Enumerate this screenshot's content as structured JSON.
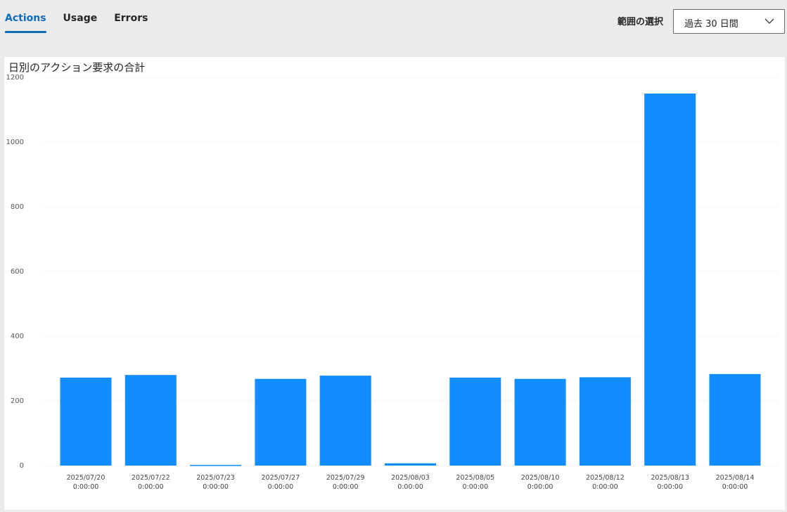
{
  "tabs": [
    {
      "label": "Actions",
      "active": true
    },
    {
      "label": "Usage",
      "active": false
    },
    {
      "label": "Errors",
      "active": false
    }
  ],
  "range": {
    "label": "範囲の選択",
    "selected": "過去 30 日間"
  },
  "colors": {
    "accent": "#0f6cbd",
    "bar": "#118dff",
    "background": "#ebebeb",
    "card": "#ffffff",
    "gridline": "#d6d6d6"
  },
  "icons": {
    "dropdown": "chevron-down-icon"
  },
  "chart_data": {
    "type": "bar",
    "title": "日別のアクション要求の合計",
    "xlabel": "",
    "ylabel": "",
    "ylim": [
      0,
      1200
    ],
    "yticks": [
      0,
      200,
      400,
      600,
      800,
      1000,
      1200
    ],
    "grid": true,
    "categories": [
      [
        "2025/07/20",
        "0:00:00"
      ],
      [
        "2025/07/22",
        "0:00:00"
      ],
      [
        "2025/07/23",
        "0:00:00"
      ],
      [
        "2025/07/27",
        "0:00:00"
      ],
      [
        "2025/07/29",
        "0:00:00"
      ],
      [
        "2025/08/03",
        "0:00:00"
      ],
      [
        "2025/08/05",
        "0:00:00"
      ],
      [
        "2025/08/10",
        "0:00:00"
      ],
      [
        "2025/08/12",
        "0:00:00"
      ],
      [
        "2025/08/13",
        "0:00:00"
      ],
      [
        "2025/08/14",
        "0:00:00"
      ]
    ],
    "values": [
      272,
      280,
      2,
      268,
      278,
      7,
      272,
      268,
      273,
      1150,
      283
    ]
  }
}
